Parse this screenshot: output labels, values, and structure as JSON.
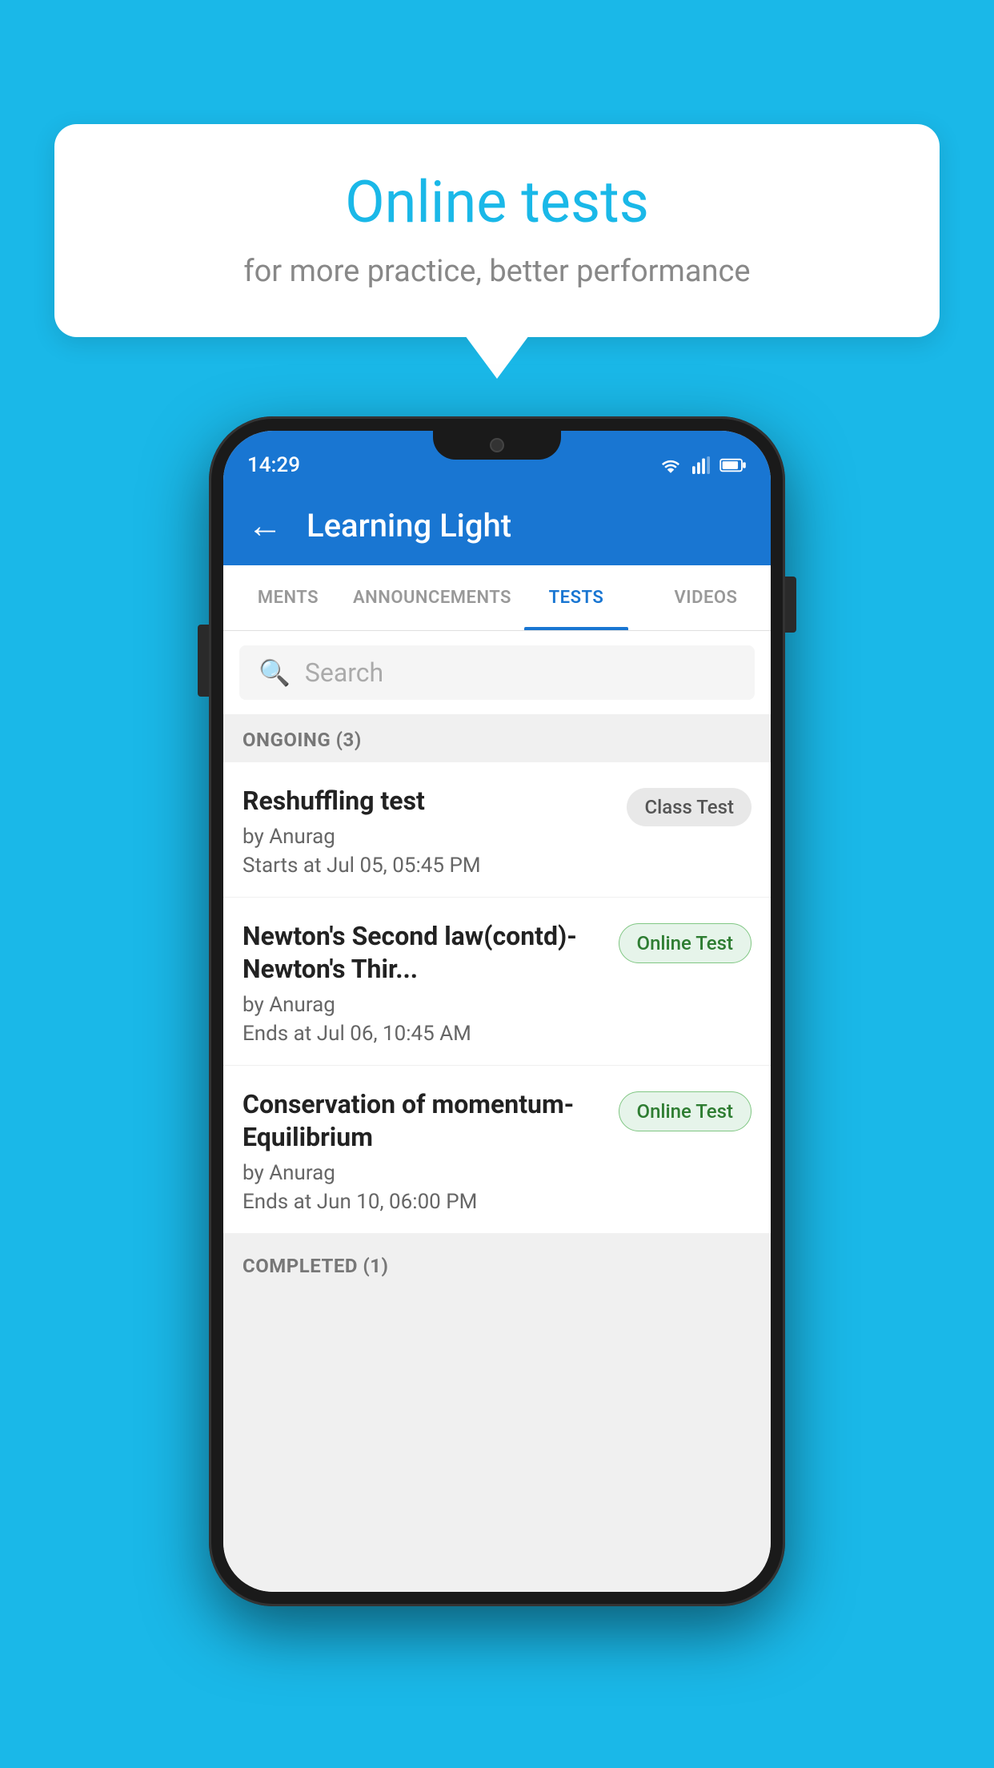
{
  "background": {
    "color": "#1ab8e8"
  },
  "speech_bubble": {
    "title": "Online tests",
    "subtitle": "for more practice, better performance"
  },
  "phone": {
    "status_bar": {
      "time": "14:29"
    },
    "app_bar": {
      "title": "Learning Light",
      "back_label": "←"
    },
    "tabs": [
      {
        "id": "assignments",
        "label": "MENTS",
        "active": false
      },
      {
        "id": "announcements",
        "label": "ANNOUNCEMENTS",
        "active": false
      },
      {
        "id": "tests",
        "label": "TESTS",
        "active": true
      },
      {
        "id": "videos",
        "label": "VIDEOS",
        "active": false
      }
    ],
    "search": {
      "placeholder": "Search"
    },
    "ongoing_section": {
      "label": "ONGOING (3)"
    },
    "test_items": [
      {
        "id": "test-1",
        "name": "Reshuffling test",
        "author": "by Anurag",
        "date_label": "Starts at  Jul 05, 05:45 PM",
        "badge": "Class Test",
        "badge_type": "class"
      },
      {
        "id": "test-2",
        "name": "Newton's Second law(contd)-Newton's Thir...",
        "author": "by Anurag",
        "date_label": "Ends at  Jul 06, 10:45 AM",
        "badge": "Online Test",
        "badge_type": "online"
      },
      {
        "id": "test-3",
        "name": "Conservation of momentum-Equilibrium",
        "author": "by Anurag",
        "date_label": "Ends at  Jun 10, 06:00 PM",
        "badge": "Online Test",
        "badge_type": "online"
      }
    ],
    "completed_section": {
      "label": "COMPLETED (1)"
    }
  }
}
